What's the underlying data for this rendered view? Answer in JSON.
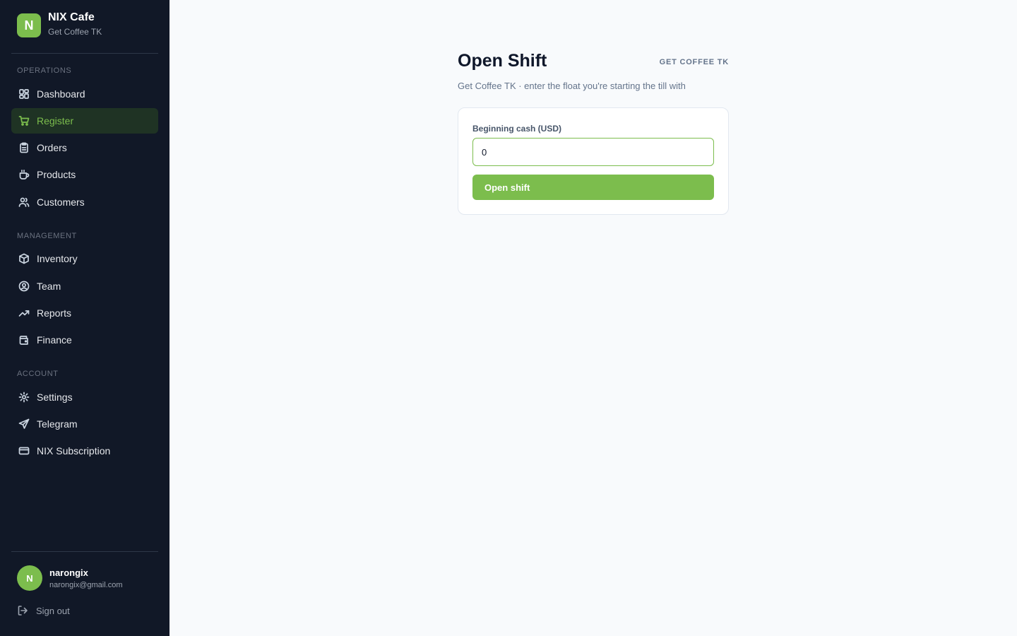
{
  "brand": {
    "logo_letter": "N",
    "name": "NIX Cafe",
    "subtitle": "Get Coffee TK"
  },
  "sections": {
    "operations": "OPERATIONS",
    "management": "MANAGEMENT",
    "account": "ACCOUNT"
  },
  "nav": {
    "dashboard": "Dashboard",
    "register": "Register",
    "orders": "Orders",
    "products": "Products",
    "customers": "Customers",
    "inventory": "Inventory",
    "team": "Team",
    "reports": "Reports",
    "finance": "Finance",
    "settings": "Settings",
    "telegram": "Telegram",
    "subscription": "NIX Subscription"
  },
  "active_nav": "register",
  "user": {
    "initial": "N",
    "name": "narongix",
    "email": "narongix@gmail.com"
  },
  "signout_label": "Sign out",
  "main": {
    "title": "Open Shift",
    "org_tag": "GET COFFEE TK",
    "subtitle": "Get Coffee TK · enter the float you're starting the till with",
    "field_label": "Beginning cash (USD)",
    "field_value": "0",
    "button_label": "Open shift"
  },
  "colors": {
    "accent": "#7cbd4d",
    "sidebar_bg": "#111827",
    "page_bg": "#f8fafc"
  }
}
